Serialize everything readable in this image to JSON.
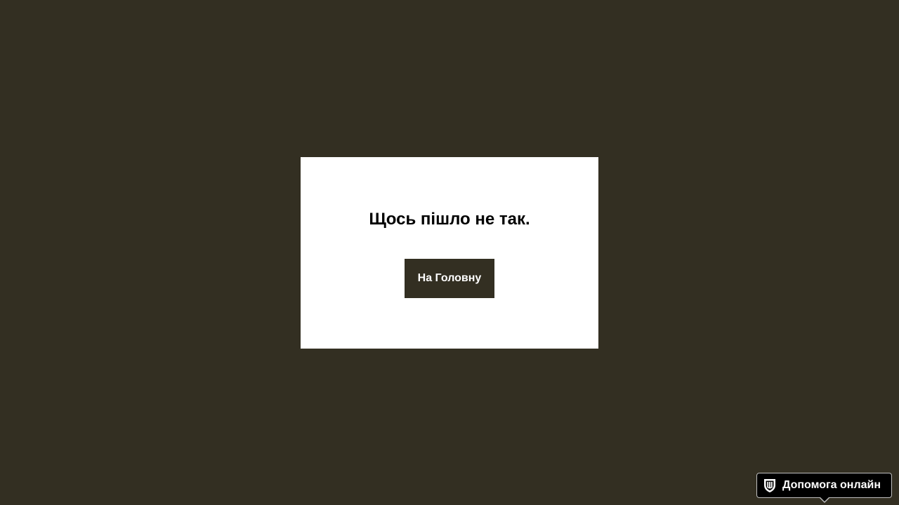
{
  "error_card": {
    "title": "Щось пішло не так.",
    "home_button_label": "На Головну"
  },
  "help_widget": {
    "label": "Допомога онлайн",
    "icon": "shield-emblem-icon"
  },
  "colors": {
    "background": "#332f22",
    "card": "#ffffff",
    "button": "#332f22",
    "widget": "#000000"
  }
}
